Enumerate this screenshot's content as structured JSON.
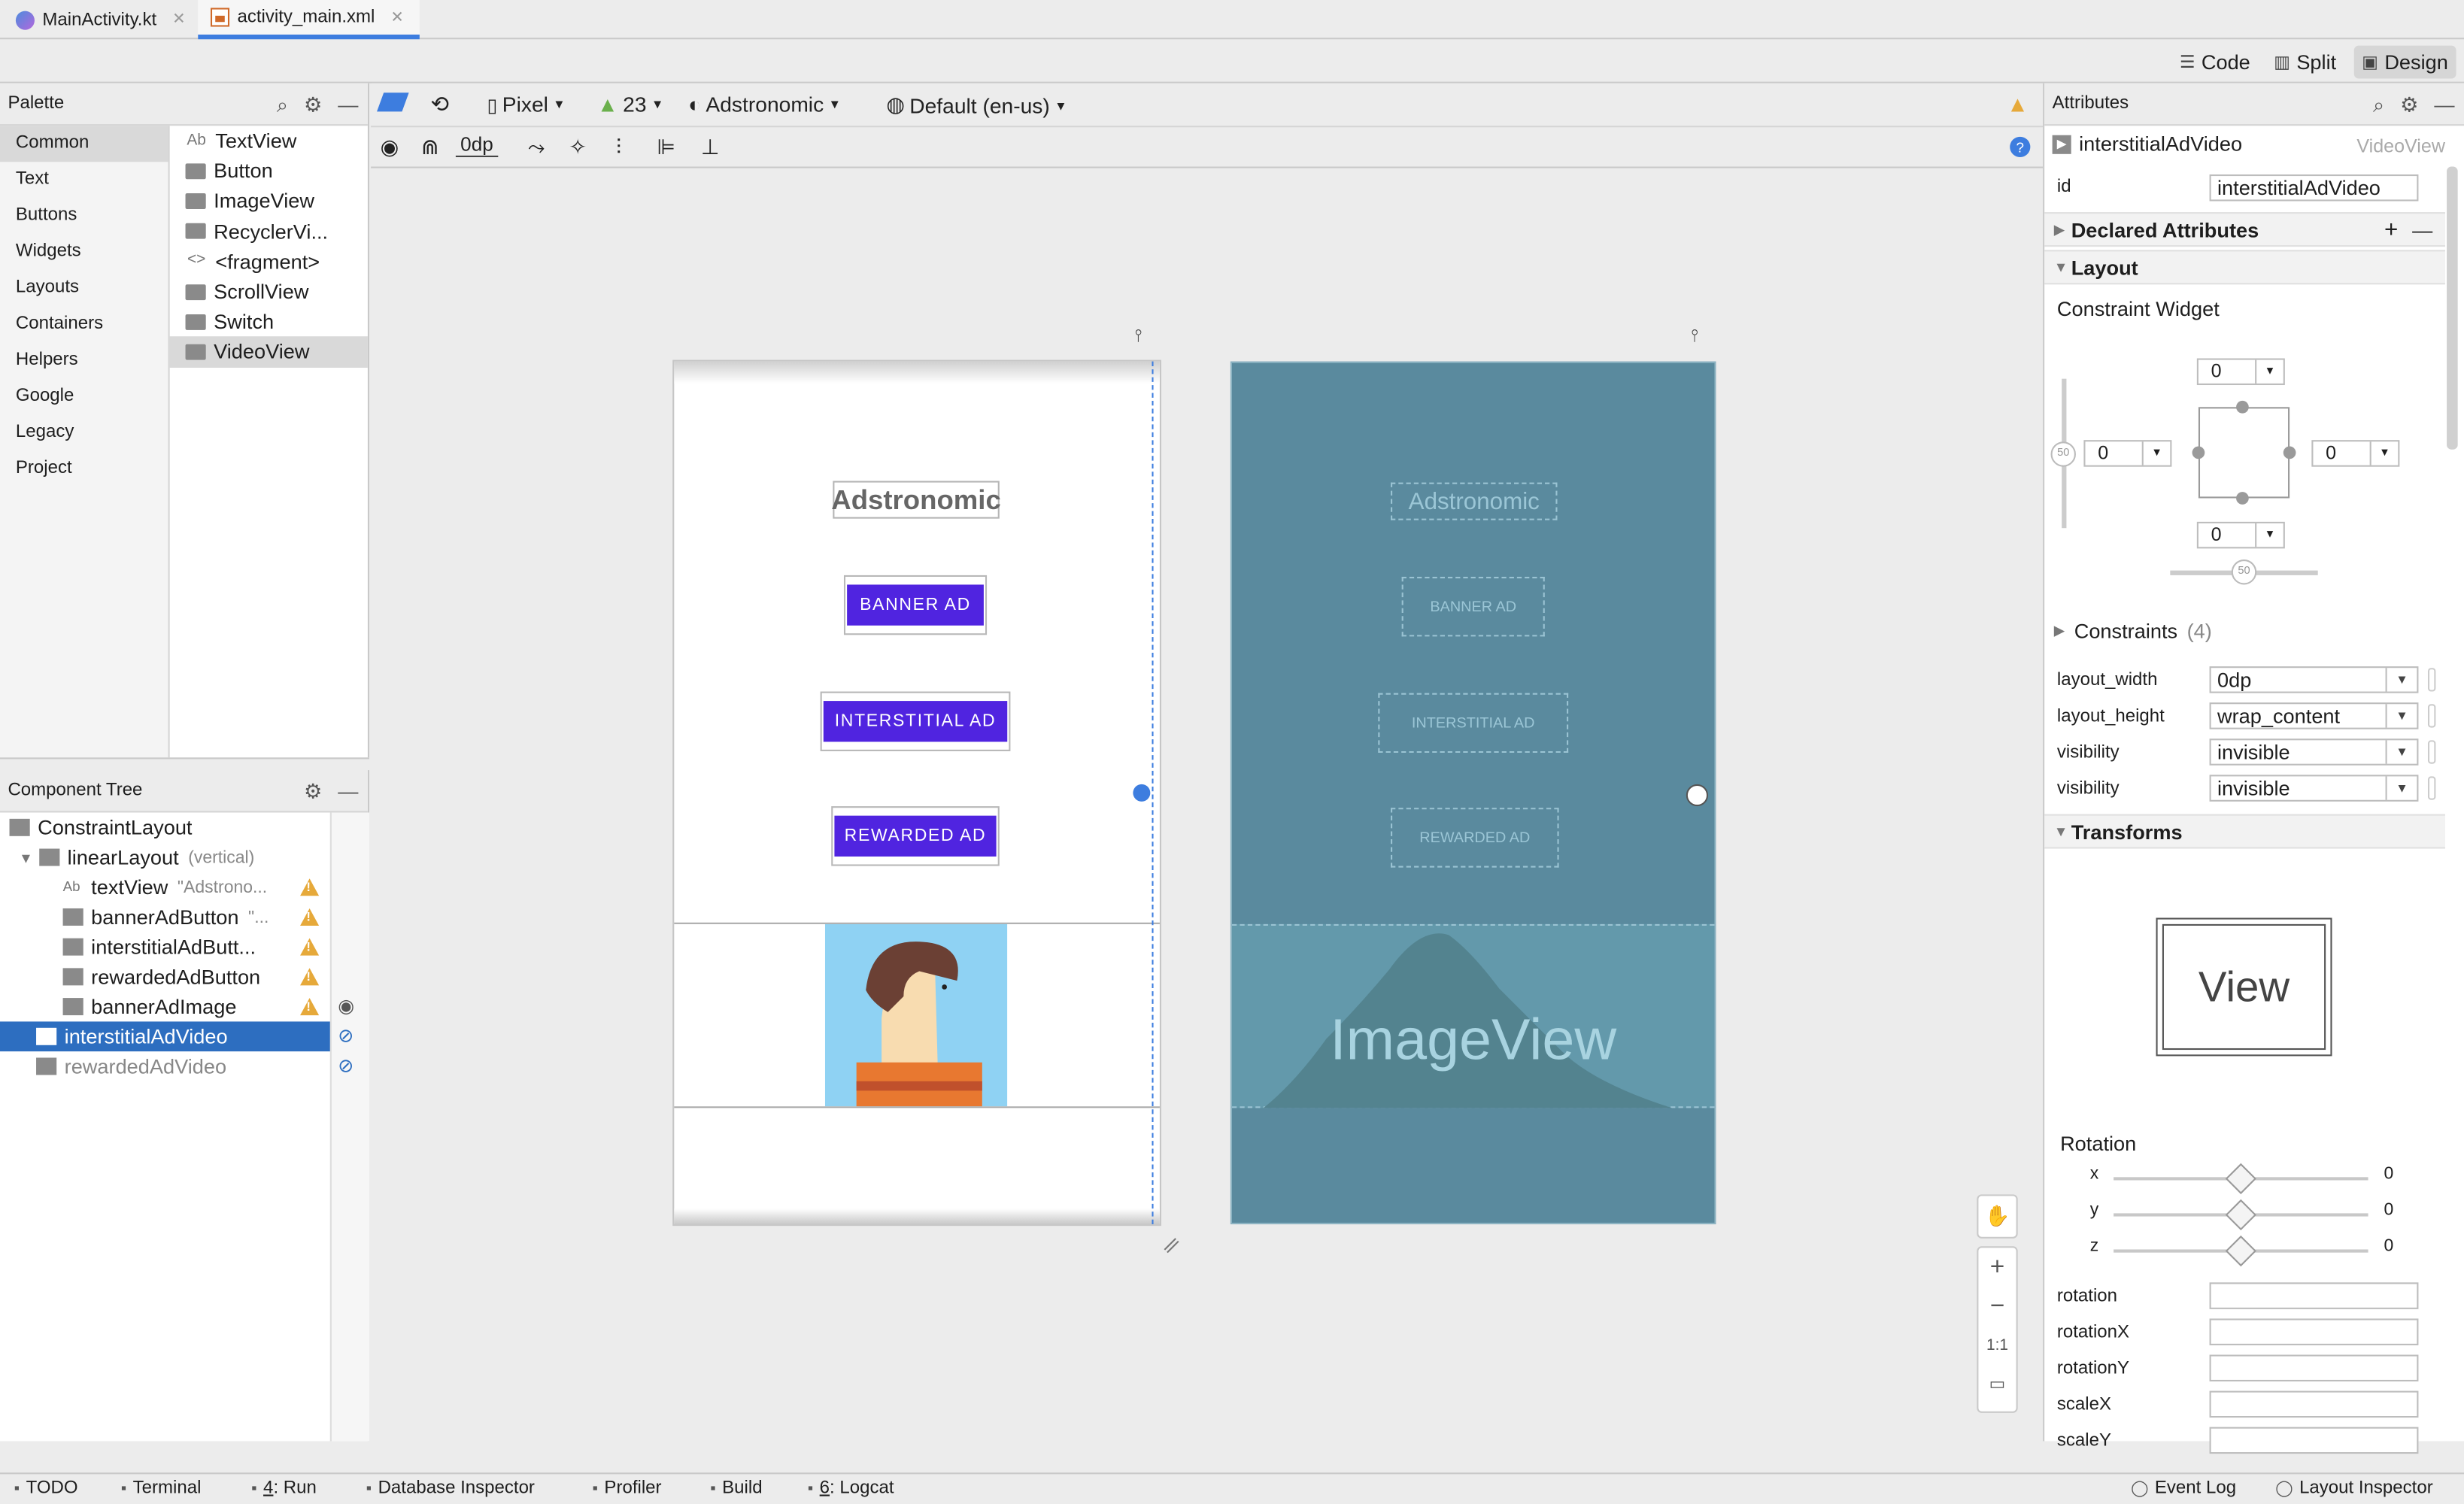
{
  "tabs": [
    {
      "label": "MainActivity.kt",
      "active": false
    },
    {
      "label": "activity_main.xml",
      "active": true
    }
  ],
  "view_modes": {
    "code": "Code",
    "split": "Split",
    "design": "Design"
  },
  "palette": {
    "title": "Palette",
    "categories": [
      "Common",
      "Text",
      "Buttons",
      "Widgets",
      "Layouts",
      "Containers",
      "Helpers",
      "Google",
      "Legacy",
      "Project"
    ],
    "widgets": [
      {
        "label": "TextView",
        "icon": "textview-icon",
        "glyph": "Ab"
      },
      {
        "label": "Button",
        "icon": "button-icon"
      },
      {
        "label": "ImageView",
        "icon": "imageview-icon"
      },
      {
        "label": "RecyclerVi...",
        "icon": "recyclerview-icon"
      },
      {
        "label": "<fragment>",
        "icon": "fragment-icon",
        "glyph": "<>"
      },
      {
        "label": "ScrollView",
        "icon": "scrollview-icon"
      },
      {
        "label": "Switch",
        "icon": "switch-icon"
      },
      {
        "label": "VideoView",
        "icon": "videoview-icon"
      }
    ]
  },
  "component_tree": {
    "title": "Component Tree",
    "items": [
      {
        "label": "ConstraintLayout",
        "sub": "",
        "icon": "constraintlayout-icon",
        "indent": 0
      },
      {
        "label": "linearLayout",
        "sub": "(vertical)",
        "icon": "linearlayout-icon",
        "indent": 1
      },
      {
        "label": "textView",
        "sub": "\"Adstrono...",
        "icon": "textview-icon",
        "indent": 2
      },
      {
        "label": "bannerAdButton",
        "sub": "\"...",
        "icon": "button-icon",
        "indent": 2
      },
      {
        "label": "interstitialAdButt...",
        "sub": "",
        "icon": "button-icon",
        "indent": 2
      },
      {
        "label": "rewardedAdButton",
        "sub": "",
        "icon": "button-icon",
        "indent": 2
      },
      {
        "label": "bannerAdImage",
        "sub": "",
        "icon": "imageview-icon",
        "indent": 2
      },
      {
        "label": "interstitialAdVideo",
        "sub": "",
        "icon": "videoview-icon",
        "indent": 1
      },
      {
        "label": "rewardedAdVideo",
        "sub": "",
        "icon": "videoview-icon",
        "indent": 1
      }
    ]
  },
  "design_toolbar": {
    "device": "Pixel",
    "api": "23",
    "theme": "Adstronomic",
    "locale": "Default (en-us)",
    "margin": "0dp"
  },
  "preview": {
    "title": "Adstronomic",
    "banner_btn": "BANNER AD",
    "interstitial_btn": "INTERSTITIAL AD",
    "rewarded_btn": "REWARDED AD",
    "imageview_label": "ImageView"
  },
  "attributes": {
    "title": "Attributes",
    "component_name": "interstitialAdVideo",
    "component_type": "VideoView",
    "id_label": "id",
    "id_value": "interstitialAdVideo",
    "declared": "Declared Attributes",
    "layout": "Layout",
    "constraint_widget": "Constraint Widget",
    "margins": {
      "top": "0",
      "left": "0",
      "right": "0",
      "bottom": "0"
    },
    "bias": {
      "vertical": "50",
      "horizontal": "50"
    },
    "constraints": "Constraints",
    "constraints_count": "(4)",
    "fields": [
      {
        "label": "layout_width",
        "value": "0dp"
      },
      {
        "label": "layout_height",
        "value": "wrap_content"
      },
      {
        "label": "visibility",
        "value": "invisible"
      },
      {
        "label": "visibility",
        "value": "invisible"
      }
    ],
    "transforms": "Transforms",
    "view_preview": "View",
    "rotation_title": "Rotation",
    "rotation_axes": [
      {
        "axis": "x",
        "value": "0"
      },
      {
        "axis": "y",
        "value": "0"
      },
      {
        "axis": "z",
        "value": "0"
      }
    ],
    "transform_fields": [
      "rotation",
      "rotationX",
      "rotationY",
      "scaleX",
      "scaleY"
    ]
  },
  "statusbar": {
    "left": [
      {
        "label": "TODO",
        "icon": "list-icon",
        "mn": ""
      },
      {
        "label": "Terminal",
        "icon": "terminal-icon",
        "mn": ""
      },
      {
        "label": ": Run",
        "icon": "run-icon",
        "mn": "4"
      },
      {
        "label": "Database Inspector",
        "icon": "database-icon",
        "mn": ""
      },
      {
        "label": "Profiler",
        "icon": "profiler-icon",
        "mn": ""
      },
      {
        "label": "Build",
        "icon": "hammer-icon",
        "mn": ""
      },
      {
        "label": ": Logcat",
        "icon": "logcat-icon",
        "mn": "6"
      }
    ],
    "right": [
      {
        "label": "Event Log",
        "icon": "event-log-icon"
      },
      {
        "label": "Layout Inspector",
        "icon": "layout-inspector-icon"
      }
    ]
  },
  "zoom": {
    "fit": "1:1"
  },
  "colors": {
    "accent": "#3d7ddf",
    "button": "#5024e0",
    "blueprint": "#5a8a9e",
    "selection": "#2d6ec0",
    "warning": "#e6a93a"
  }
}
